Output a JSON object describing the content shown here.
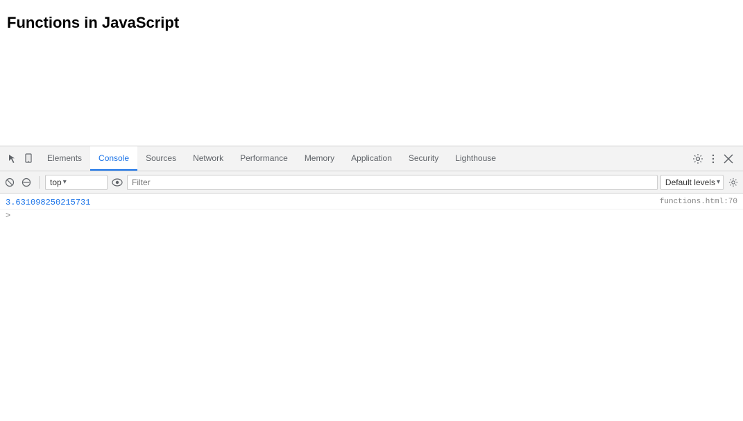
{
  "page": {
    "title": "Functions in JavaScript"
  },
  "devtools": {
    "tabs": [
      {
        "id": "elements",
        "label": "Elements",
        "active": false
      },
      {
        "id": "console",
        "label": "Console",
        "active": true
      },
      {
        "id": "sources",
        "label": "Sources",
        "active": false
      },
      {
        "id": "network",
        "label": "Network",
        "active": false
      },
      {
        "id": "performance",
        "label": "Performance",
        "active": false
      },
      {
        "id": "memory",
        "label": "Memory",
        "active": false
      },
      {
        "id": "application",
        "label": "Application",
        "active": false
      },
      {
        "id": "security",
        "label": "Security",
        "active": false
      },
      {
        "id": "lighthouse",
        "label": "Lighthouse",
        "active": false
      }
    ],
    "toolbar": {
      "context": "top",
      "filter_placeholder": "Filter",
      "levels_label": "Default levels"
    },
    "console": {
      "log_value": "3.631098250215731",
      "log_source": "functions.html:70",
      "prompt_symbol": ">"
    }
  }
}
